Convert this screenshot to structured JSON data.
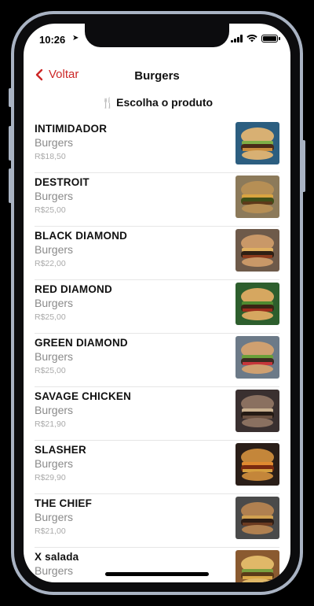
{
  "status_bar": {
    "time": "10:26"
  },
  "navbar": {
    "back_label": "Voltar",
    "title": "Burgers"
  },
  "subtitle": "Escolha o produto",
  "colors": {
    "accent": "#cc2727"
  },
  "products": [
    {
      "name": "INTIMIDADOR",
      "category": "Burgers",
      "price": "R$18,50"
    },
    {
      "name": "DESTROIT",
      "category": "Burgers",
      "price": "R$25,00"
    },
    {
      "name": "BLACK DIAMOND",
      "category": "Burgers",
      "price": "R$22,00"
    },
    {
      "name": "RED DIAMOND",
      "category": "Burgers",
      "price": "R$25,00"
    },
    {
      "name": "GREEN DIAMOND",
      "category": "Burgers",
      "price": "R$25,00"
    },
    {
      "name": "SAVAGE CHICKEN",
      "category": "Burgers",
      "price": "R$21,90"
    },
    {
      "name": "SLASHER",
      "category": "Burgers",
      "price": "R$29,90"
    },
    {
      "name": "THE CHIEF",
      "category": "Burgers",
      "price": "R$21,00"
    },
    {
      "name": "X salada",
      "category": "Burgers",
      "price": ""
    }
  ]
}
